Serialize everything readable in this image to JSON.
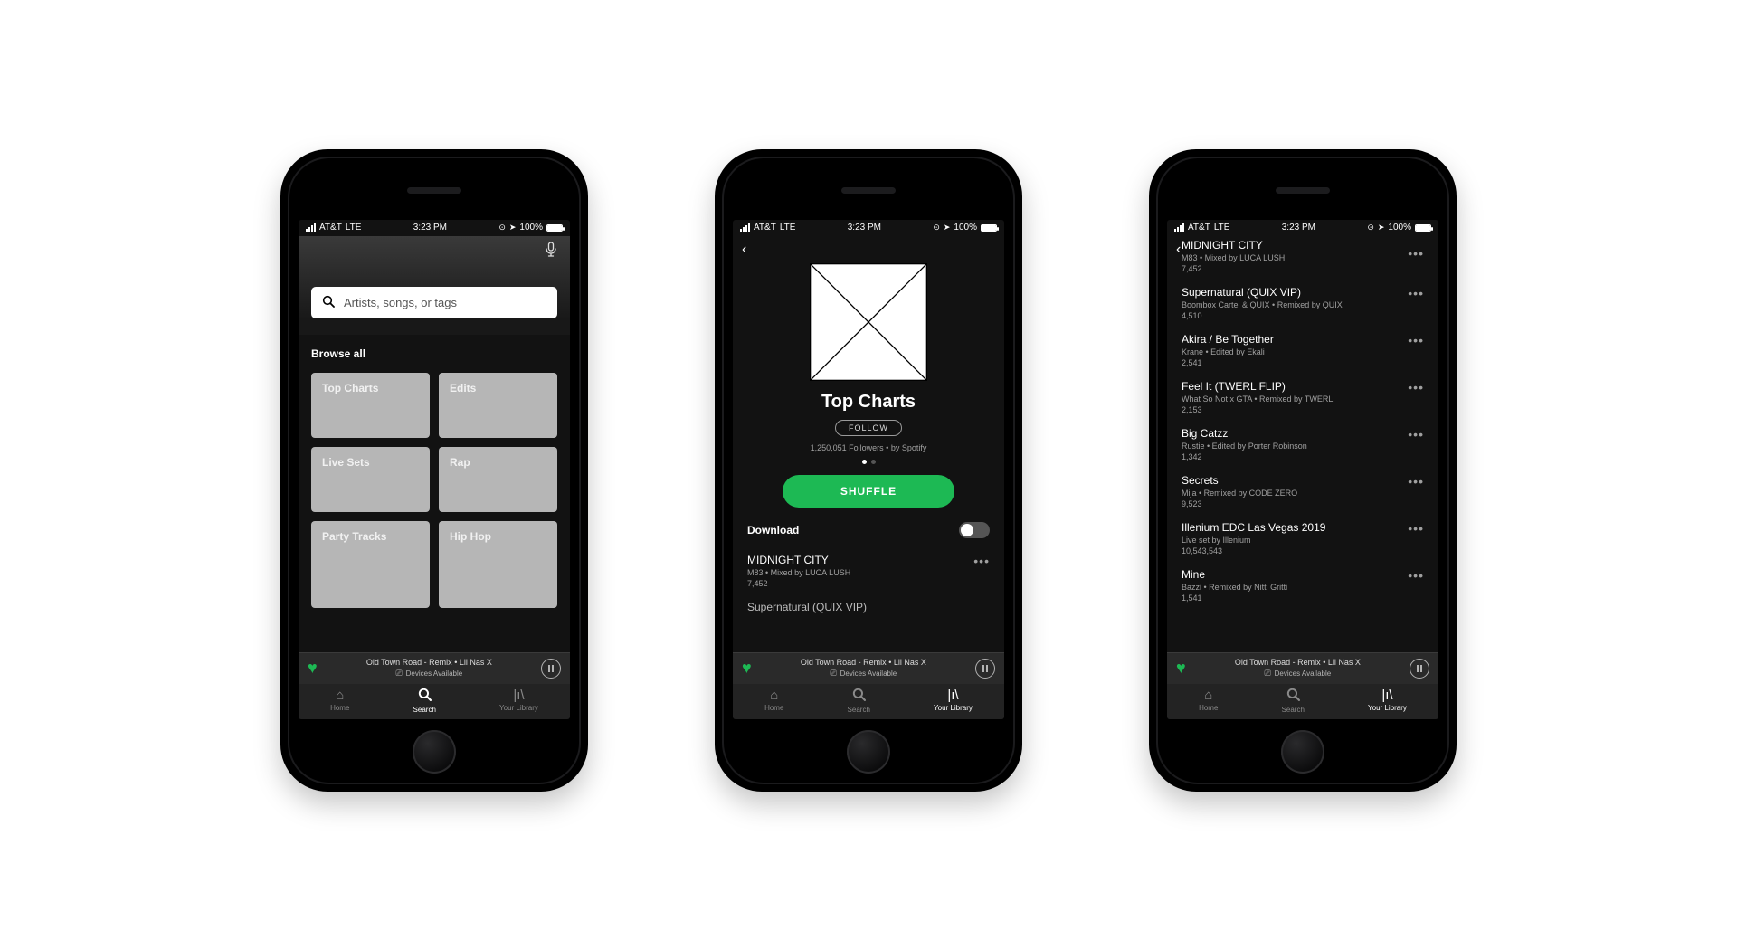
{
  "status": {
    "carrier": "AT&T",
    "network": "LTE",
    "time": "3:23 PM",
    "battery_pct": "100%"
  },
  "now_playing": {
    "title": "Old Town Road - Remix",
    "artist": "Lil Nas X",
    "devices_label": "Devices Available"
  },
  "tabs": {
    "home": "Home",
    "search": "Search",
    "library": "Your Library"
  },
  "screen1": {
    "search_placeholder": "Artists, songs, or tags",
    "browse_label": "Browse all",
    "categories": [
      "Top Charts",
      "Edits",
      "Live Sets",
      "Rap",
      "Party Tracks",
      "Hip Hop"
    ]
  },
  "screen2": {
    "title": "Top Charts",
    "follow_label": "FOLLOW",
    "followers_line": "1,250,051 Followers • by Spotify",
    "shuffle_label": "SHUFFLE",
    "download_label": "Download",
    "tracks": [
      {
        "title": "MIDNIGHT CITY",
        "sub": "M83 • Mixed by LUCA LUSH",
        "count": "7,452"
      },
      {
        "title": "Supernatural (QUIX VIP)",
        "sub": "",
        "count": ""
      }
    ]
  },
  "screen3": {
    "tracks": [
      {
        "title": "MIDNIGHT CITY",
        "sub": "M83 • Mixed by LUCA LUSH",
        "count": "7,452"
      },
      {
        "title": "Supernatural (QUIX VIP)",
        "sub": "Boombox Cartel & QUIX • Remixed by QUIX",
        "count": "4,510"
      },
      {
        "title": "Akira / Be Together",
        "sub": "Krane • Edited by Ekali",
        "count": "2,541"
      },
      {
        "title": "Feel It (TWERL FLIP)",
        "sub": "What So Not x GTA • Remixed by TWERL",
        "count": "2,153"
      },
      {
        "title": "Big Catzz",
        "sub": "Rustie • Edited by Porter Robinson",
        "count": "1,342"
      },
      {
        "title": "Secrets",
        "sub": "Mija • Remixed by CODE ZERO",
        "count": "9,523"
      },
      {
        "title": "Illenium EDC Las Vegas 2019",
        "sub": "Live set by Illenium",
        "count": "10,543,543"
      },
      {
        "title": "Mine",
        "sub": "Bazzi • Remixed by Nitti Gritti",
        "count": "1,541"
      }
    ]
  }
}
